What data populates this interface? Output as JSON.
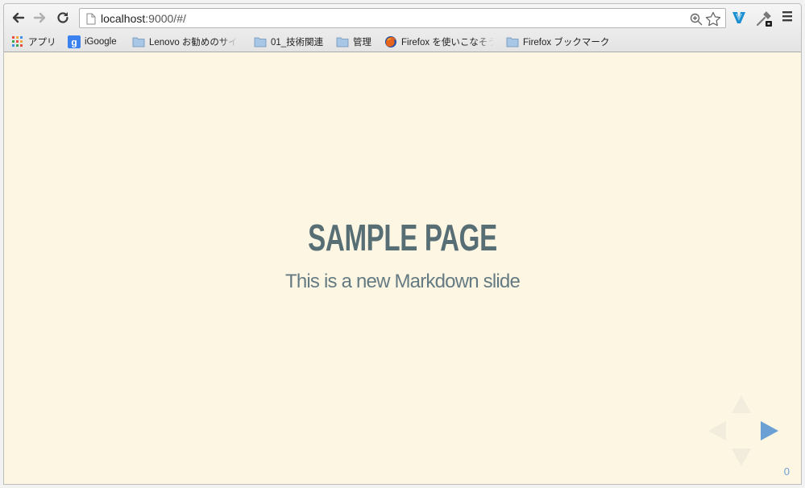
{
  "browser": {
    "url": {
      "host": "localhost",
      "rest": ":9000/#/"
    },
    "bookmarks": [
      {
        "label": "アプリ",
        "icon": "apps-grid-icon"
      },
      {
        "label": "iGoogle",
        "icon": "google-icon"
      },
      {
        "label": "Lenovo お勧めのサイ",
        "icon": "folder-icon"
      },
      {
        "label": "01_技術関連",
        "icon": "folder-icon"
      },
      {
        "label": "管理",
        "icon": "folder-icon"
      },
      {
        "label": "Firefox を使いこなそう",
        "icon": "firefox-icon"
      },
      {
        "label": "Firefox ブックマーク",
        "icon": "folder-icon"
      }
    ]
  },
  "slide": {
    "title": "SAMPLE PAGE",
    "subtitle": "This is a new Markdown slide",
    "number": "0"
  },
  "colors": {
    "background": "#fdf6e3",
    "heading": "#586e75",
    "text": "#657b83",
    "accent": "#6aa0d4"
  }
}
